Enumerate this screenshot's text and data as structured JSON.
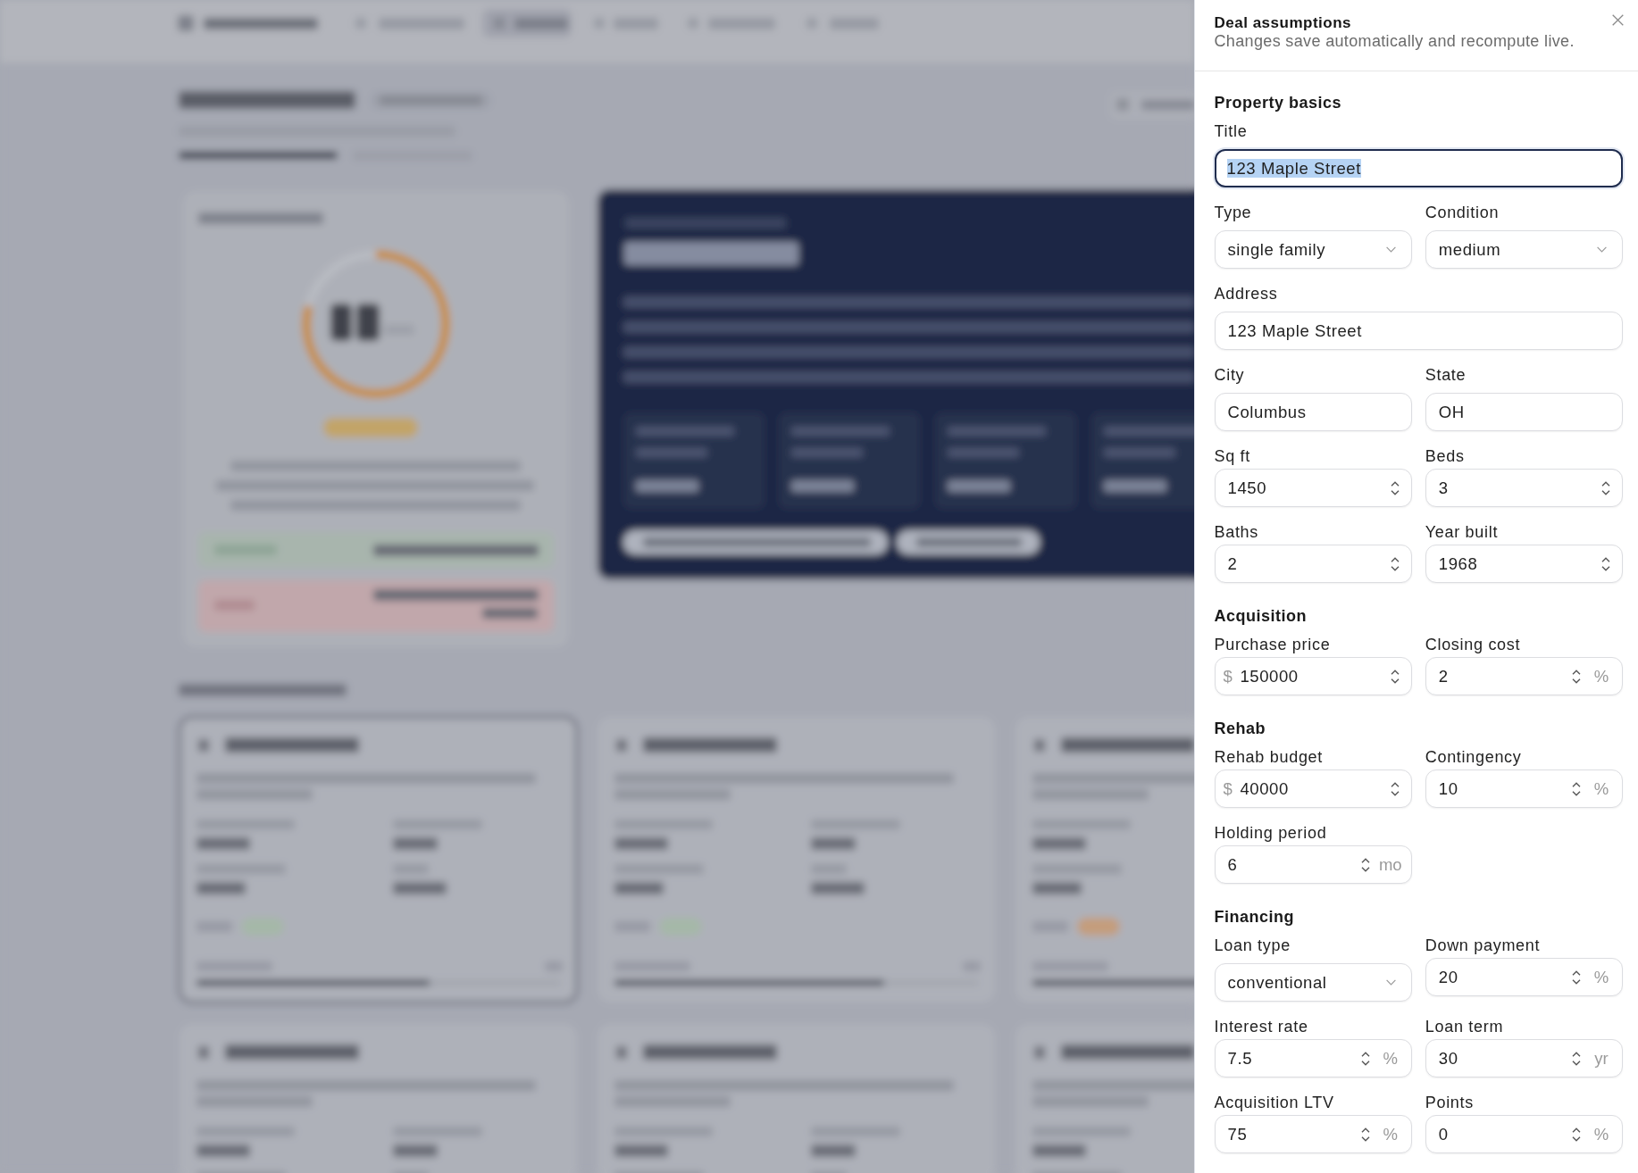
{
  "panel": {
    "title": "Deal assumptions",
    "subtitle": "Changes save automatically and recompute live.",
    "sections": [
      {
        "heading": "Property basics",
        "fields": [
          {
            "label": "Title",
            "kind": "text",
            "value": "123 Maple Street",
            "wide": true,
            "focused": true,
            "text_selected": true
          },
          {
            "label": "Type",
            "kind": "select",
            "value": "single family",
            "wide": false,
            "focused": false,
            "text_selected": false
          },
          {
            "label": "Condition",
            "kind": "select",
            "value": "medium",
            "wide": false,
            "focused": false,
            "text_selected": false
          },
          {
            "label": "Address",
            "kind": "text",
            "value": "123 Maple Street",
            "wide": true,
            "focused": false,
            "text_selected": false
          },
          {
            "label": "City",
            "kind": "text",
            "value": "Columbus",
            "wide": false,
            "focused": false,
            "text_selected": false
          },
          {
            "label": "State",
            "kind": "text",
            "value": "OH",
            "wide": false,
            "focused": false,
            "text_selected": false
          },
          {
            "label": "Sq ft",
            "kind": "number",
            "value": "1450",
            "wide": false,
            "focused": false,
            "text_selected": false
          },
          {
            "label": "Beds",
            "kind": "number",
            "value": "3",
            "wide": false,
            "focused": false,
            "text_selected": false
          },
          {
            "label": "Baths",
            "kind": "number",
            "value": "2",
            "wide": false,
            "focused": false,
            "text_selected": false
          },
          {
            "label": "Year built",
            "kind": "number",
            "value": "1968",
            "wide": false,
            "focused": false,
            "text_selected": false
          }
        ]
      },
      {
        "heading": "Acquisition",
        "fields": [
          {
            "label": "Purchase price",
            "kind": "number",
            "prefix": "$",
            "value": "150000",
            "wide": false,
            "focused": false,
            "text_selected": false
          },
          {
            "label": "Closing cost",
            "kind": "number",
            "value": "2",
            "suffix": "%",
            "wide": false,
            "focused": false,
            "text_selected": false
          }
        ]
      },
      {
        "heading": "Rehab",
        "fields": [
          {
            "label": "Rehab budget",
            "kind": "number",
            "prefix": "$",
            "value": "40000",
            "wide": false,
            "focused": false,
            "text_selected": false
          },
          {
            "label": "Contingency",
            "kind": "number",
            "value": "10",
            "suffix": "%",
            "wide": false,
            "focused": false,
            "text_selected": false
          },
          {
            "label": "Holding period",
            "kind": "number",
            "value": "6",
            "suffix": "mo",
            "wide": false,
            "focused": false,
            "text_selected": false
          }
        ]
      },
      {
        "heading": "Financing",
        "fields": [
          {
            "label": "Loan type",
            "kind": "select",
            "value": "conventional",
            "wide": false,
            "focused": false,
            "text_selected": false
          },
          {
            "label": "Down payment",
            "kind": "number",
            "value": "20",
            "suffix": "%",
            "wide": false,
            "focused": false,
            "text_selected": false
          },
          {
            "label": "Interest rate",
            "kind": "number",
            "value": "7.5",
            "suffix": "%",
            "wide": false,
            "focused": false,
            "text_selected": false
          },
          {
            "label": "Loan term",
            "kind": "number",
            "value": "30",
            "suffix": "yr",
            "wide": false,
            "focused": false,
            "text_selected": false
          },
          {
            "label": "Acquisition LTV",
            "kind": "number",
            "value": "75",
            "suffix": "%",
            "wide": false,
            "focused": false,
            "text_selected": false
          },
          {
            "label": "Points",
            "kind": "number",
            "value": "0",
            "suffix": "%",
            "wide": false,
            "focused": false,
            "text_selected": false
          }
        ]
      }
    ]
  }
}
